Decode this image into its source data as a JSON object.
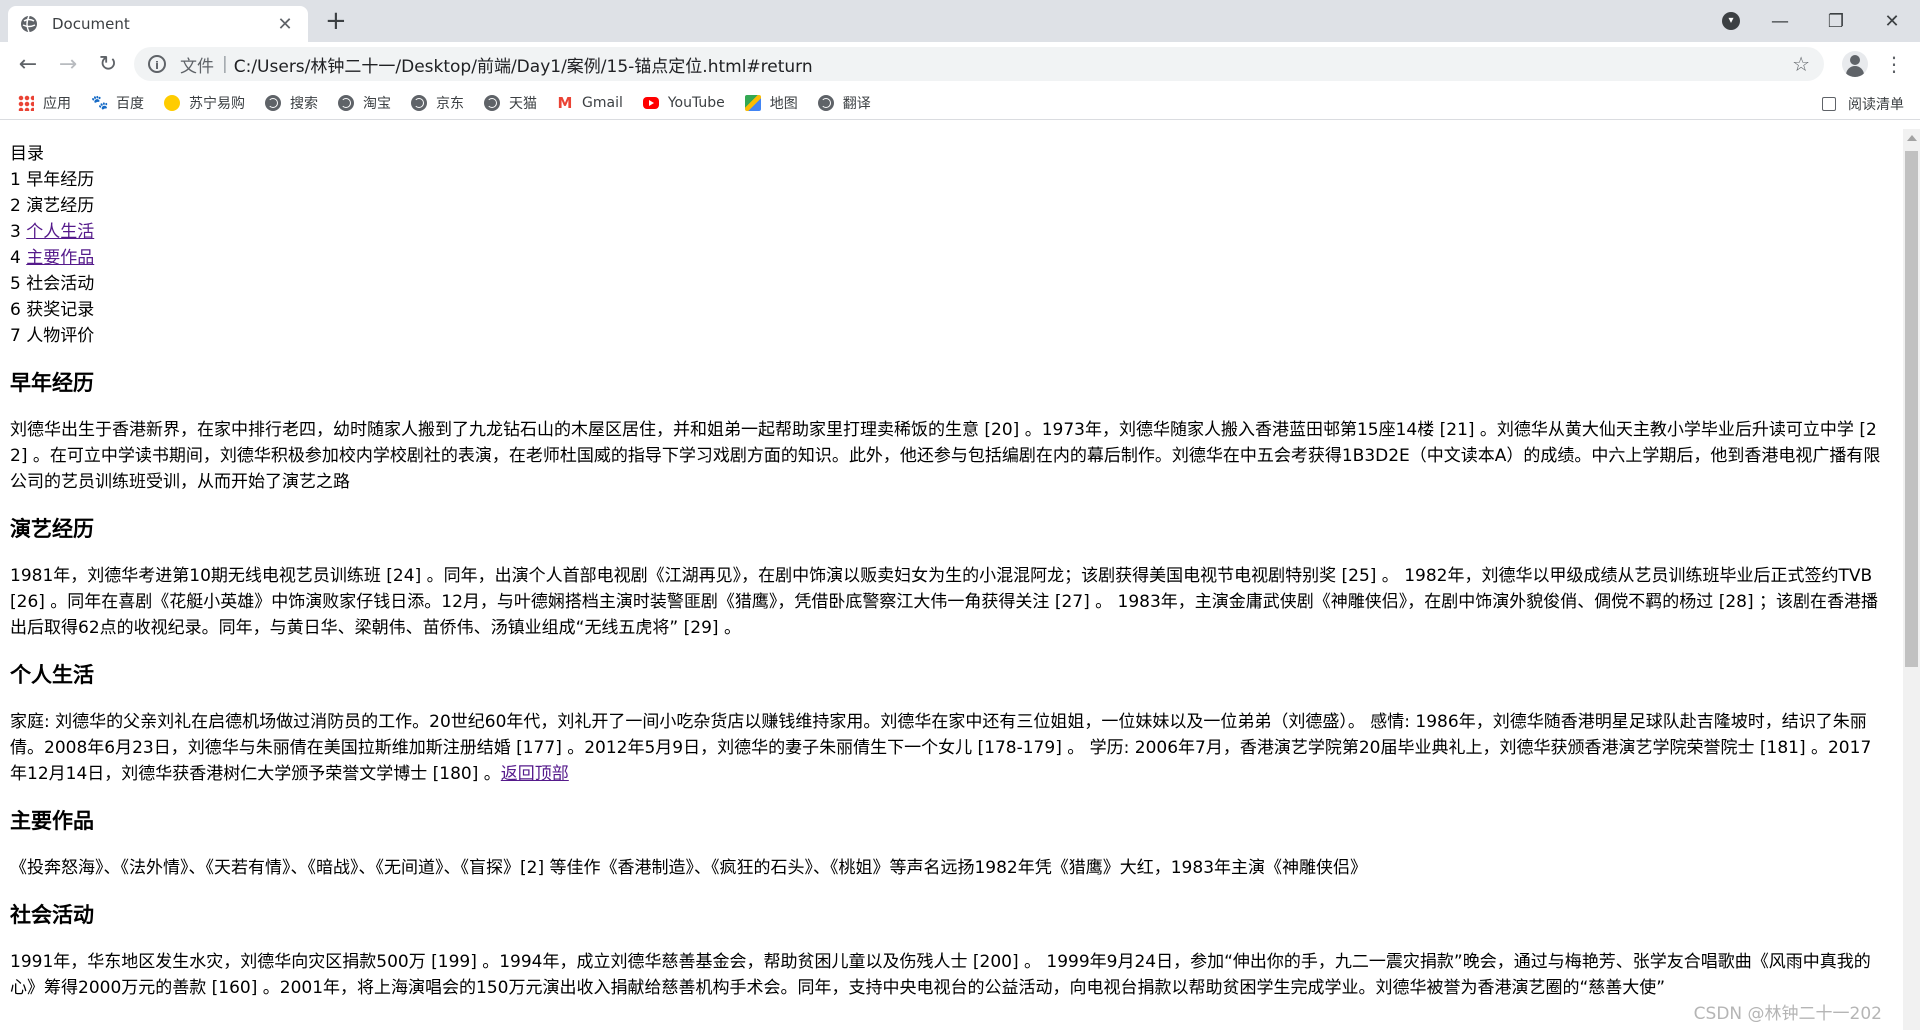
{
  "browser": {
    "tab_title": "Document",
    "tab_close": "✕",
    "new_tab": "+",
    "url_scheme": "文件",
    "url_sep": "|",
    "url": "C:/Users/林钟二十一/Desktop/前端/Day1/案例/15-锚点定位.html#return",
    "window": {
      "minimize": "—",
      "restore": "❐",
      "close": "✕"
    },
    "bookmarks": [
      {
        "label": "应用",
        "icon": "apps-grid-icon"
      },
      {
        "label": "百度",
        "icon": "baidu-paw-icon"
      },
      {
        "label": "苏宁易购",
        "icon": "suning-icon"
      },
      {
        "label": "搜索",
        "icon": "globe-icon"
      },
      {
        "label": "淘宝",
        "icon": "globe-icon"
      },
      {
        "label": "京东",
        "icon": "globe-icon"
      },
      {
        "label": "天猫",
        "icon": "globe-icon"
      },
      {
        "label": "Gmail",
        "icon": "gmail-icon"
      },
      {
        "label": "YouTube",
        "icon": "youtube-icon"
      },
      {
        "label": "地图",
        "icon": "maps-icon"
      },
      {
        "label": "翻译",
        "icon": "globe-icon"
      }
    ],
    "reading_list": "阅读清单"
  },
  "toc": {
    "title": "目录",
    "items": [
      {
        "num": "1",
        "label": "早年经历",
        "link": false
      },
      {
        "num": "2",
        "label": "演艺经历",
        "link": false
      },
      {
        "num": "3",
        "label": "个人生活",
        "link": true
      },
      {
        "num": "4",
        "label": "主要作品",
        "link": true
      },
      {
        "num": "5",
        "label": "社会活动",
        "link": false
      },
      {
        "num": "6",
        "label": "获奖记录",
        "link": false
      },
      {
        "num": "7",
        "label": "人物评价",
        "link": false
      }
    ]
  },
  "sections": {
    "early": {
      "title": "早年经历",
      "text": "刘德华出生于香港新界，在家中排行老四，幼时随家人搬到了九龙钻石山的木屋区居住，并和姐弟一起帮助家里打理卖稀饭的生意 [20] 。1973年，刘德华随家人搬入香港蓝田邨第15座14楼 [21] 。刘德华从黄大仙天主教小学毕业后升读可立中学 [22] 。在可立中学读书期间，刘德华积极参加校内学校剧社的表演，在老师杜国威的指导下学习戏剧方面的知识。此外，他还参与包括编剧在内的幕后制作。刘德华在中五会考获得1B3D2E（中文读本A）的成绩。中六上学期后，他到香港电视广播有限公司的艺员训练班受训，从而开始了演艺之路"
    },
    "career": {
      "title": "演艺经历",
      "text": "1981年，刘德华考进第10期无线电视艺员训练班 [24] 。同年，出演个人首部电视剧《江湖再见》，在剧中饰演以贩卖妇女为生的小混混阿龙；该剧获得美国电视节电视剧特别奖 [25] 。 1982年，刘德华以甲级成绩从艺员训练班毕业后正式签约TVB [26] 。同年在喜剧《花艇小英雄》中饰演败家仔钱日添。12月，与叶德娴搭档主演时装警匪剧《猎鹰》，凭借卧底警察江大伟一角获得关注 [27] 。 1983年，主演金庸武侠剧《神雕侠侣》，在剧中饰演外貌俊俏、倜傥不羁的杨过 [28] ；该剧在香港播出后取得62点的收视纪录。同年，与黄日华、梁朝伟、苗侨伟、汤镇业组成“无线五虎将” [29] 。"
    },
    "personal": {
      "title": "个人生活",
      "text": "家庭: 刘德华的父亲刘礼在启德机场做过消防员的工作。20世纪60年代，刘礼开了一间小吃杂货店以赚钱维持家用。刘德华在家中还有三位姐姐，一位妹妹以及一位弟弟（刘德盛）。 感情: 1986年，刘德华随香港明星足球队赴吉隆坡时，结识了朱丽倩。2008年6月23日，刘德华与朱丽倩在美国拉斯维加斯注册结婚 [177] 。2012年5月9日，刘德华的妻子朱丽倩生下一个女儿 [178-179] 。 学历: 2006年7月，香港演艺学院第20届毕业典礼上，刘德华获颁香港演艺学院荣誉院士 [181] 。2017年12月14日，刘德华获香港树仁大学颁予荣誉文学博士 [180] 。",
      "back_top": "返回顶部"
    },
    "works": {
      "title": "主要作品",
      "text": "《投奔怒海》、《法外情》、《天若有情》、《暗战》、《无间道》、《盲探》[2] 等佳作《香港制造》、《疯狂的石头》、《桃姐》等声名远扬1982年凭《猎鹰》大红，1983年主演《神雕侠侣》"
    },
    "social": {
      "title": "社会活动",
      "text": "1991年，华东地区发生水灾，刘德华向灾区捐款500万 [199] 。1994年，成立刘德华慈善基金会，帮助贫困儿童以及伤残人士 [200] 。 1999年9月24日，参加“伸出你的手，九二一震灾捐款”晚会，通过与梅艳芳、张学友合唱歌曲《风雨中真我的心》筹得2000万元的善款 [160] 。2001年，将上海演唱会的150万元演出收入捐献给慈善机构手术会。同年，支持中央电视台的公益活动，向电视台捐款以帮助贫困学生完成学业。刘德华被誉为香港演艺圈的“慈善大使”"
    }
  },
  "watermark": "CSDN @林钟二十一202"
}
